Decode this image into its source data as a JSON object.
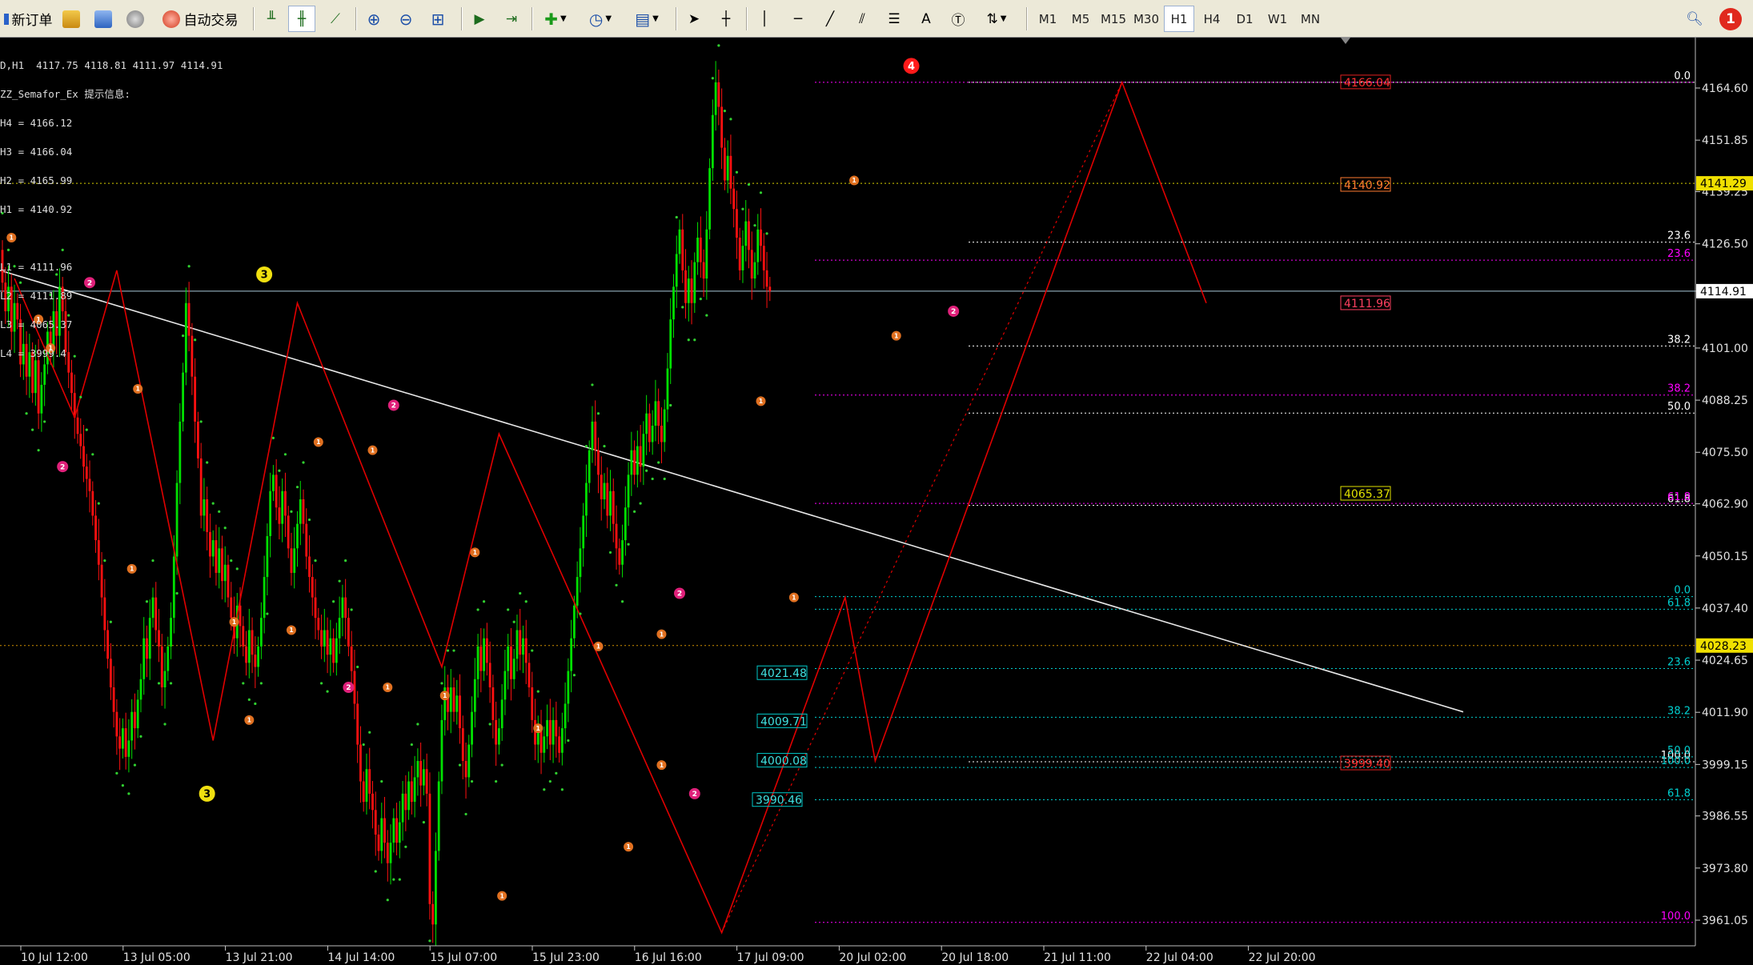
{
  "toolbar": {
    "new_order_label": "新订单",
    "auto_trading_label": "自动交易",
    "timeframes": [
      "M1",
      "M5",
      "M15",
      "M30",
      "H1",
      "H4",
      "D1",
      "W1",
      "MN"
    ],
    "active_timeframe": "H1",
    "notification_count": "1"
  },
  "chart_info": {
    "header": "D,H1  4117.75 4118.81 4111.97 4114.91",
    "indicator_name": "ZZ_Semafor_Ex 提示信息:",
    "lines": [
      "H4 = 4166.12",
      "H3 = 4166.04",
      "H2 = 4165.99",
      "H1 = 4140.92",
      "",
      "L1 = 4111.96",
      "L2 = 4111.89",
      "L3 = 4065.37",
      "L4 = 3999.4"
    ]
  },
  "price_axis": {
    "ticks": [
      "4164.60",
      "4151.85",
      "4139.25",
      "4126.50",
      "4114.91",
      "4101.00",
      "4088.25",
      "4075.50",
      "4062.90",
      "4050.15",
      "4037.40",
      "4024.65",
      "4011.90",
      "3999.15",
      "3986.55",
      "3973.80",
      "3961.05"
    ],
    "current_price": "4114.91",
    "marker_4141": "4141.29",
    "marker_4028": "4028.23"
  },
  "time_axis": [
    "10 Jul 12:00",
    "13 Jul 05:00",
    "13 Jul 21:00",
    "14 Jul 14:00",
    "15 Jul 07:00",
    "15 Jul 23:00",
    "16 Jul 16:00",
    "17 Jul 09:00",
    "20 Jul 02:00",
    "20 Jul 18:00",
    "21 Jul 11:00",
    "22 Jul 04:00",
    "22 Jul 20:00"
  ],
  "price_labels": [
    "4166.04",
    "4140.92",
    "4111.96",
    "4065.37",
    "3999.40",
    "4021.48",
    "4009.71",
    "4000.08",
    "3990.46"
  ],
  "fib_labels": {
    "upper": [
      "0.0",
      "23.6",
      "38.2",
      "50.0",
      "61.8",
      "100.0"
    ],
    "magenta": [
      "23.6",
      "38.2",
      "61.8",
      "100.0"
    ],
    "cyan": [
      "0.0",
      "61.8",
      "23.6",
      "38.2",
      "50.0",
      "100.0",
      "61.8"
    ]
  },
  "semafor_labels": [
    "1",
    "2",
    "3",
    "4"
  ],
  "colors": {
    "bull": "#00e000",
    "bear": "#ff1010",
    "zigzag": "#e00000",
    "trendline": "#e8e8e8",
    "current": "#a8c8d8",
    "fib_upper": "#ffffff",
    "fib_magenta": "#ff00ff",
    "fib_cyan": "#00d0d0",
    "level_yellow": "#e0d000"
  },
  "chart_data": {
    "type": "candlestick",
    "symbol_timeframe": "H1",
    "ylim": [
      3955,
      4172
    ],
    "last_ohlc": [
      4117.75,
      4118.81,
      4111.97,
      4114.91
    ],
    "zigzag": [
      [
        4,
        4118
      ],
      [
        24,
        4084
      ],
      [
        38,
        4120
      ],
      [
        70,
        4005
      ],
      [
        98,
        4112
      ],
      [
        146,
        4023
      ],
      [
        165,
        4080
      ],
      [
        239,
        3958
      ],
      [
        280,
        4040
      ],
      [
        290,
        4000
      ],
      [
        372,
        4166
      ],
      [
        400,
        4112
      ]
    ],
    "bars": [
      [
        4125,
        4117
      ],
      [
        4117,
        4110
      ],
      [
        4110,
        4116
      ],
      [
        4116,
        4105
      ],
      [
        4105,
        4112
      ],
      [
        4112,
        4108
      ],
      [
        4108,
        4097
      ],
      [
        4097,
        4102
      ],
      [
        4102,
        4094
      ],
      [
        4094,
        4100
      ],
      [
        4100,
        4090
      ],
      [
        4090,
        4098
      ],
      [
        4098,
        4085
      ],
      [
        4085,
        4092
      ],
      [
        4092,
        4097
      ],
      [
        4097,
        4105
      ],
      [
        4105,
        4100
      ],
      [
        4100,
        4110
      ],
      [
        4110,
        4104
      ],
      [
        4104,
        4116
      ],
      [
        4116,
        4110
      ],
      [
        4110,
        4100
      ],
      [
        4100,
        4095
      ],
      [
        4095,
        4090
      ],
      [
        4090,
        4084
      ],
      [
        4084,
        4080
      ],
      [
        4080,
        4077
      ],
      [
        4077,
        4072
      ],
      [
        4072,
        4069
      ],
      [
        4069,
        4066
      ],
      [
        4066,
        4060
      ],
      [
        4060,
        4054
      ],
      [
        4054,
        4048
      ],
      [
        4048,
        4040
      ],
      [
        4040,
        4032
      ],
      [
        4032,
        4025
      ],
      [
        4025,
        4018
      ],
      [
        4018,
        4012
      ],
      [
        4012,
        4006
      ],
      [
        4006,
        4003
      ],
      [
        4003,
        4008
      ],
      [
        4008,
        4001
      ],
      [
        4001,
        4005
      ],
      [
        4005,
        4012
      ],
      [
        4012,
        4008
      ],
      [
        4008,
        4015
      ],
      [
        4015,
        4020
      ],
      [
        4020,
        4030
      ],
      [
        4030,
        4025
      ],
      [
        4025,
        4035
      ],
      [
        4035,
        4040
      ],
      [
        4040,
        4032
      ],
      [
        4032,
        4028
      ],
      [
        4028,
        4018
      ],
      [
        4018,
        4022
      ],
      [
        4022,
        4028
      ],
      [
        4028,
        4035
      ],
      [
        4035,
        4050
      ],
      [
        4050,
        4068
      ],
      [
        4068,
        4083
      ],
      [
        4083,
        4095
      ],
      [
        4095,
        4112
      ],
      [
        4112,
        4104
      ],
      [
        4104,
        4094
      ],
      [
        4094,
        4083
      ],
      [
        4083,
        4074
      ],
      [
        4074,
        4060
      ],
      [
        4060,
        4064
      ],
      [
        4064,
        4056
      ],
      [
        4056,
        4050
      ],
      [
        4050,
        4054
      ],
      [
        4054,
        4046
      ],
      [
        4046,
        4052
      ],
      [
        4052,
        4044
      ],
      [
        4044,
        4048
      ],
      [
        4048,
        4040
      ],
      [
        4040,
        4035
      ],
      [
        4035,
        4030
      ],
      [
        4030,
        4038
      ],
      [
        4038,
        4033
      ],
      [
        4033,
        4028
      ],
      [
        4028,
        4024
      ],
      [
        4024,
        4032
      ],
      [
        4032,
        4026
      ],
      [
        4026,
        4023
      ],
      [
        4023,
        4028
      ],
      [
        4028,
        4035
      ],
      [
        4035,
        4045
      ],
      [
        4045,
        4055
      ],
      [
        4055,
        4066
      ],
      [
        4066,
        4070
      ],
      [
        4070,
        4062
      ],
      [
        4062,
        4058
      ],
      [
        4058,
        4066
      ],
      [
        4066,
        4060
      ],
      [
        4060,
        4052
      ],
      [
        4052,
        4046
      ],
      [
        4046,
        4052
      ],
      [
        4052,
        4058
      ],
      [
        4058,
        4064
      ],
      [
        4064,
        4058
      ],
      [
        4058,
        4050
      ],
      [
        4050,
        4045
      ],
      [
        4045,
        4040
      ],
      [
        4040,
        4035
      ],
      [
        4035,
        4032
      ],
      [
        4032,
        4028
      ],
      [
        4028,
        4032
      ],
      [
        4032,
        4026
      ],
      [
        4026,
        4030
      ],
      [
        4030,
        4024
      ],
      [
        4024,
        4030
      ],
      [
        4030,
        4035
      ],
      [
        4035,
        4040
      ],
      [
        4040,
        4035
      ],
      [
        4035,
        4028
      ],
      [
        4028,
        4022
      ],
      [
        4022,
        4014
      ],
      [
        4014,
        4004
      ],
      [
        4004,
        3995
      ],
      [
        3995,
        3990
      ],
      [
        3990,
        3998
      ],
      [
        3998,
        3992
      ],
      [
        3992,
        3988
      ],
      [
        3988,
        3982
      ],
      [
        3982,
        3978
      ],
      [
        3978,
        3986
      ],
      [
        3986,
        3980
      ],
      [
        3980,
        3975
      ],
      [
        3975,
        3980
      ],
      [
        3980,
        3986
      ],
      [
        3986,
        3980
      ],
      [
        3980,
        3985
      ],
      [
        3985,
        3992
      ],
      [
        3992,
        3988
      ],
      [
        3988,
        3995
      ],
      [
        3995,
        3990
      ],
      [
        3990,
        3996
      ],
      [
        3996,
        4000
      ],
      [
        4000,
        3994
      ],
      [
        3994,
        3998
      ],
      [
        3998,
        3992
      ],
      [
        3992,
        3965
      ],
      [
        3965,
        3960
      ],
      [
        3960,
        3978
      ],
      [
        3978,
        3995
      ],
      [
        3995,
        4010
      ],
      [
        4010,
        4018
      ],
      [
        4018,
        4012
      ],
      [
        4012,
        4018
      ],
      [
        4018,
        4012
      ],
      [
        4012,
        4016
      ],
      [
        4016,
        4008
      ],
      [
        4008,
        4000
      ],
      [
        4000,
        3996
      ],
      [
        3996,
        4004
      ],
      [
        4004,
        4012
      ],
      [
        4012,
        4020
      ],
      [
        4020,
        4028
      ],
      [
        4028,
        4022
      ],
      [
        4022,
        4030
      ],
      [
        4030,
        4024
      ],
      [
        4024,
        4018
      ],
      [
        4018,
        4010
      ],
      [
        4010,
        4004
      ],
      [
        4004,
        4008
      ],
      [
        4008,
        4015
      ],
      [
        4015,
        4022
      ],
      [
        4022,
        4028
      ],
      [
        4028,
        4020
      ],
      [
        4020,
        4025
      ],
      [
        4025,
        4032
      ],
      [
        4032,
        4026
      ],
      [
        4026,
        4030
      ],
      [
        4030,
        4024
      ],
      [
        4024,
        4018
      ],
      [
        4018,
        4010
      ],
      [
        4010,
        4004
      ],
      [
        4004,
        4008
      ],
      [
        4008,
        4002
      ],
      [
        4002,
        4006
      ],
      [
        4006,
        4010
      ],
      [
        4010,
        4004
      ],
      [
        4004,
        4010
      ],
      [
        4010,
        4006
      ],
      [
        4006,
        4002
      ],
      [
        4002,
        4008
      ],
      [
        4008,
        4014
      ],
      [
        4014,
        4022
      ],
      [
        4022,
        4030
      ],
      [
        4030,
        4038
      ],
      [
        4038,
        4045
      ],
      [
        4045,
        4052
      ],
      [
        4052,
        4060
      ],
      [
        4060,
        4068
      ],
      [
        4068,
        4076
      ],
      [
        4076,
        4083
      ],
      [
        4083,
        4076
      ],
      [
        4076,
        4070
      ],
      [
        4070,
        4064
      ],
      [
        4064,
        4068
      ],
      [
        4068,
        4060
      ],
      [
        4060,
        4066
      ],
      [
        4066,
        4058
      ],
      [
        4058,
        4052
      ],
      [
        4052,
        4048
      ],
      [
        4048,
        4054
      ],
      [
        4054,
        4062
      ],
      [
        4062,
        4070
      ],
      [
        4070,
        4076
      ],
      [
        4076,
        4070
      ],
      [
        4070,
        4077
      ],
      [
        4077,
        4072
      ],
      [
        4072,
        4080
      ],
      [
        4080,
        4085
      ],
      [
        4085,
        4078
      ],
      [
        4078,
        4082
      ],
      [
        4082,
        4088
      ],
      [
        4088,
        4082
      ],
      [
        4082,
        4078
      ],
      [
        4078,
        4086
      ],
      [
        4086,
        4096
      ],
      [
        4096,
        4108
      ],
      [
        4108,
        4116
      ],
      [
        4116,
        4124
      ],
      [
        4124,
        4130
      ],
      [
        4130,
        4120
      ],
      [
        4120,
        4112
      ],
      [
        4112,
        4118
      ],
      [
        4118,
        4112
      ],
      [
        4112,
        4122
      ],
      [
        4122,
        4128
      ],
      [
        4128,
        4122
      ],
      [
        4122,
        4118
      ],
      [
        4118,
        4130
      ],
      [
        4130,
        4145
      ],
      [
        4145,
        4158
      ],
      [
        4158,
        4166
      ],
      [
        4166,
        4160
      ],
      [
        4160,
        4150
      ],
      [
        4150,
        4142
      ],
      [
        4142,
        4148
      ],
      [
        4148,
        4140
      ],
      [
        4140,
        4135
      ],
      [
        4135,
        4128
      ],
      [
        4128,
        4120
      ],
      [
        4120,
        4126
      ],
      [
        4126,
        4132
      ],
      [
        4132,
        4125
      ],
      [
        4125,
        4118
      ],
      [
        4118,
        4122
      ],
      [
        4122,
        4130
      ],
      [
        4130,
        4126
      ],
      [
        4126,
        4120
      ],
      [
        4120,
        4116
      ],
      [
        4116,
        4114.91
      ]
    ]
  }
}
